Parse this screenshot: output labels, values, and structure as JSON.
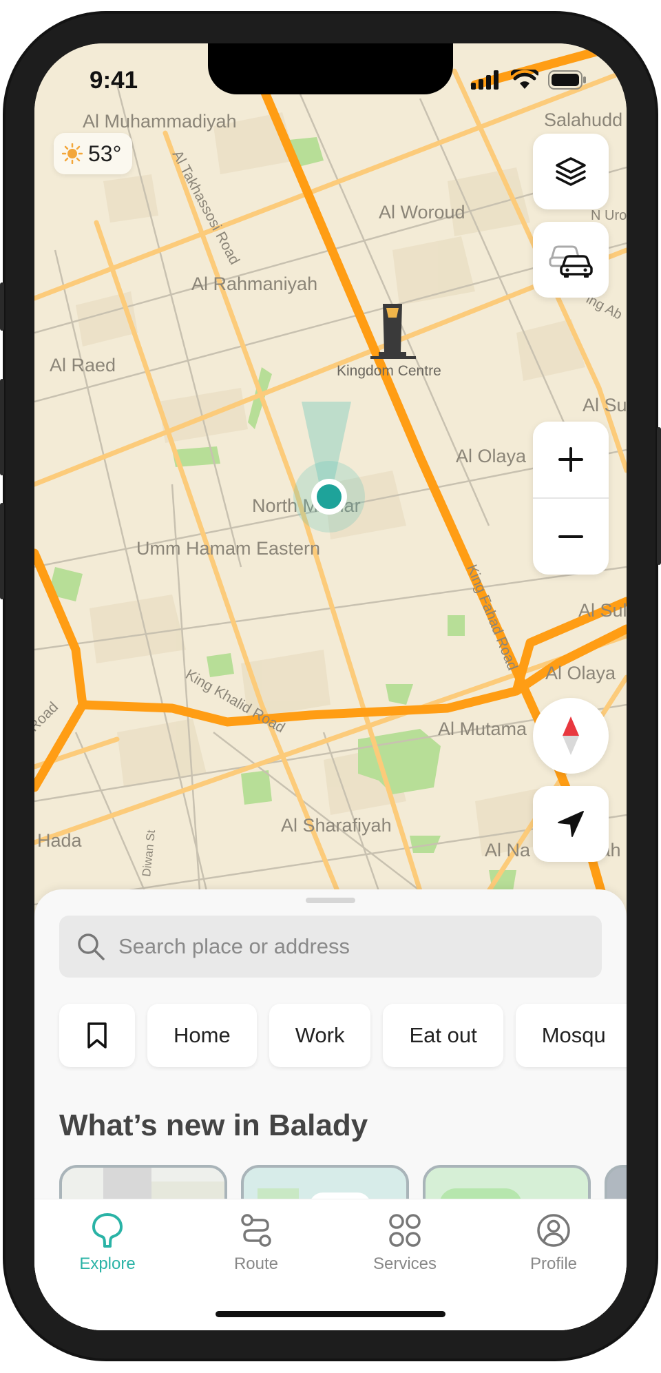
{
  "status_bar": {
    "time": "9:41"
  },
  "weather": {
    "temperature": "53°",
    "icon": "sun-icon"
  },
  "map": {
    "districts": [
      "Al Muhammadiyah",
      "Salahudd",
      "Al Woroud",
      "N Uro",
      "Al Rahmaniyah",
      "ing Ab",
      "Al Raed",
      "Kingdom Centre",
      "Al Su",
      "Al Olaya",
      "North Mathar",
      "Umm Hamam Eastern",
      "Al Sul",
      "Al Olaya",
      "Al Mutama",
      "Al Sharafiyah",
      "Hada",
      "Al Na",
      "yah"
    ],
    "roads": [
      "Al Takhassosi Road",
      "King Fahad Road",
      "King Khalid Road",
      "Road",
      "Diwan St"
    ],
    "landmark": "Kingdom Centre"
  },
  "controls": {
    "layers": "layers-icon",
    "traffic": "car-icon",
    "zoom_in": "+",
    "zoom_out": "−",
    "compass": "compass-icon",
    "locate": "navigation-arrow-icon"
  },
  "search": {
    "placeholder": "Search place or address"
  },
  "chips": [
    "Home",
    "Work",
    "Eat out",
    "Mosqu"
  ],
  "section": {
    "title": "What’s new in Balady"
  },
  "tabs": [
    {
      "label": "Explore",
      "icon": "explore-pin-icon",
      "active": true
    },
    {
      "label": "Route",
      "icon": "route-icon",
      "active": false
    },
    {
      "label": "Services",
      "icon": "grid-icon",
      "active": false
    },
    {
      "label": "Profile",
      "icon": "profile-icon",
      "active": false
    }
  ],
  "colors": {
    "accent": "#2ab3a6",
    "major_road": "#ff9d14",
    "minor_road": "#fccb7a",
    "map_bg": "#f3ebd6",
    "park": "#b7de97"
  }
}
